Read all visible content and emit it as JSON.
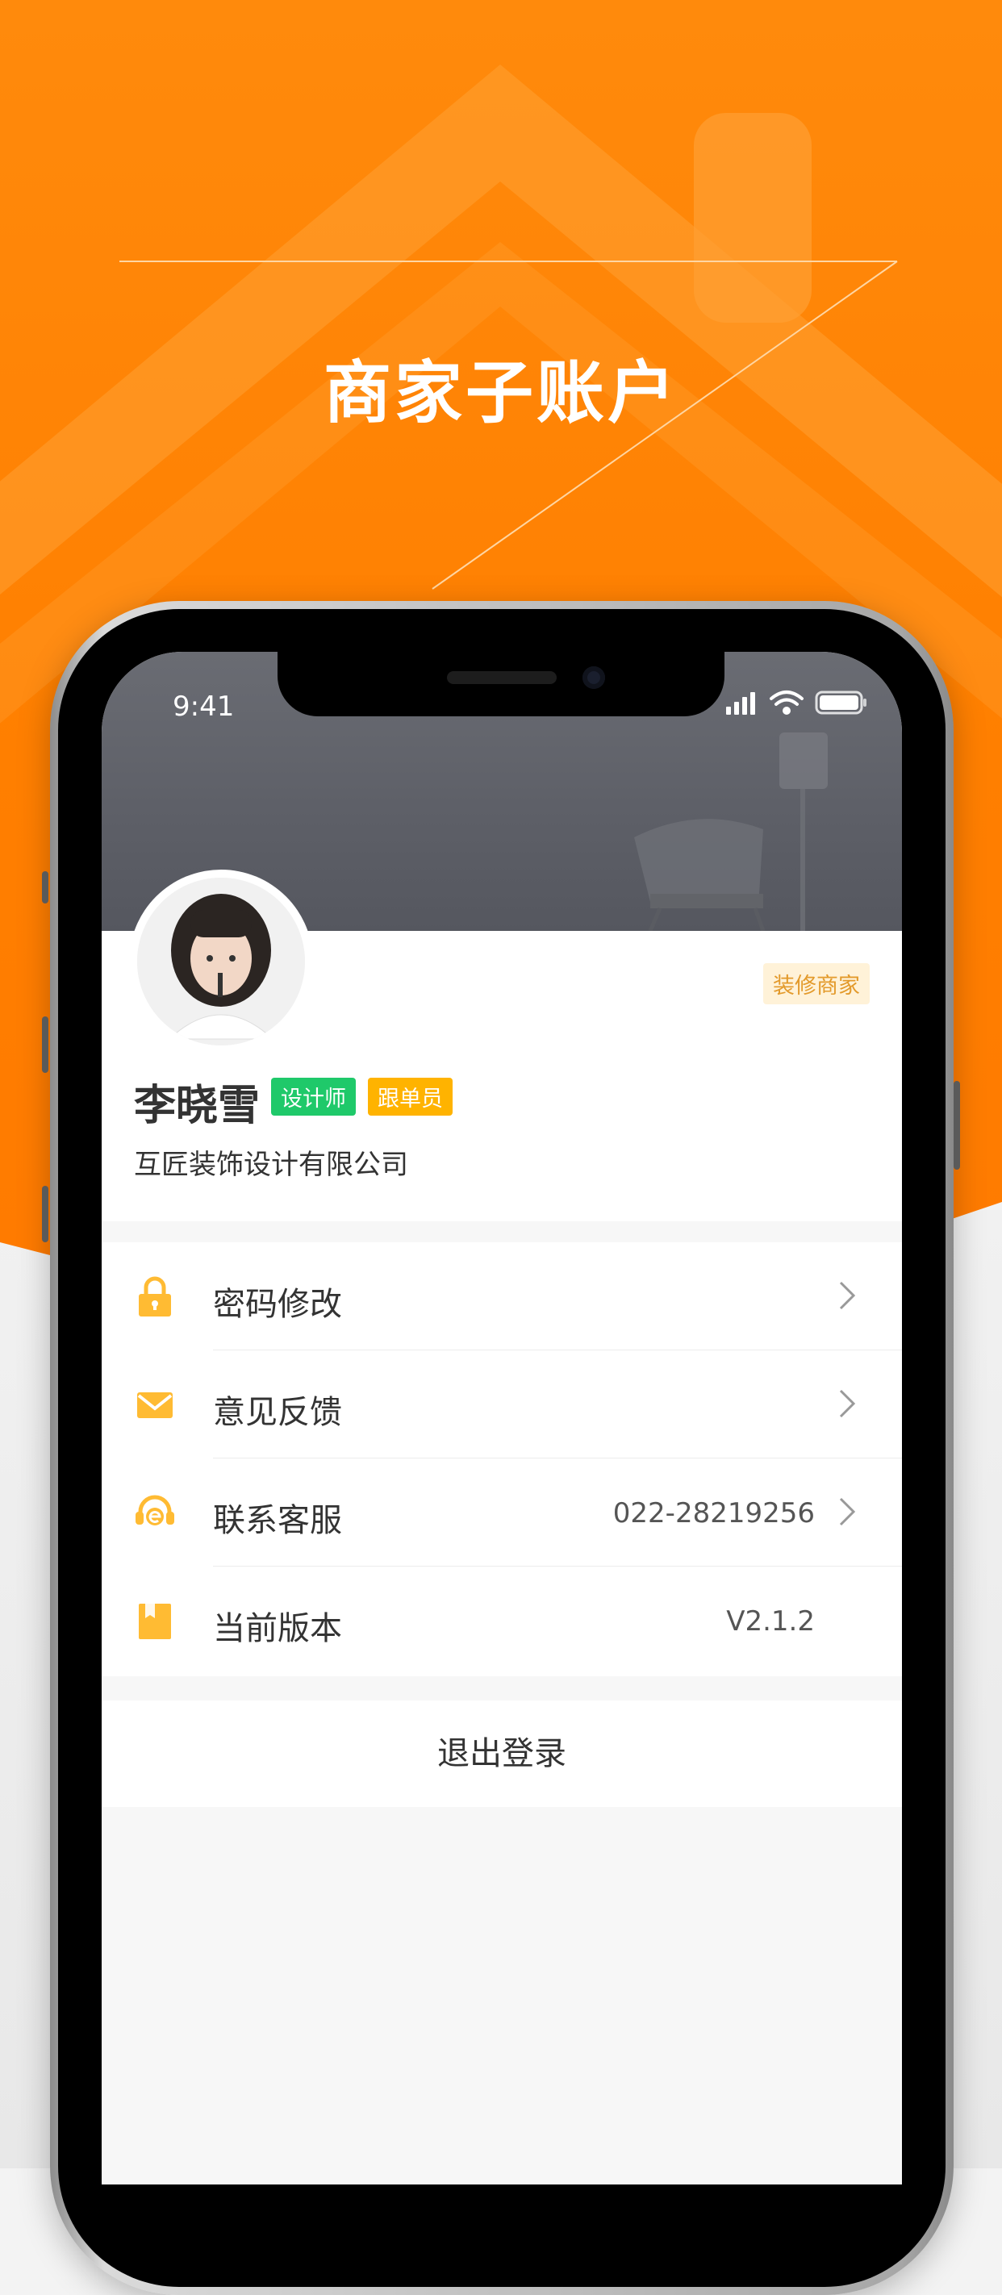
{
  "promo": {
    "title": "商家子账户"
  },
  "status_bar": {
    "time": "9:41"
  },
  "profile": {
    "merchant_tag": "装修商家",
    "name": "李晓雪",
    "tags": [
      {
        "label": "设计师",
        "color": "#1fc96a"
      },
      {
        "label": "跟单员",
        "color": "#ffb300"
      }
    ],
    "company": "互匠装饰设计有限公司"
  },
  "menu": {
    "items": [
      {
        "label": "密码修改",
        "value": "",
        "icon": "lock-icon"
      },
      {
        "label": "意见反馈",
        "value": "",
        "icon": "envelope-icon"
      },
      {
        "label": "联系客服",
        "value": "022-28219256",
        "icon": "headset-icon"
      },
      {
        "label": "当前版本",
        "value": "V2.1.2",
        "icon": "bookmark-icon"
      }
    ]
  },
  "logout_label": "退出登录",
  "colors": {
    "brand_orange": "#ff8000",
    "icon_yellow": "#ffbb33"
  }
}
